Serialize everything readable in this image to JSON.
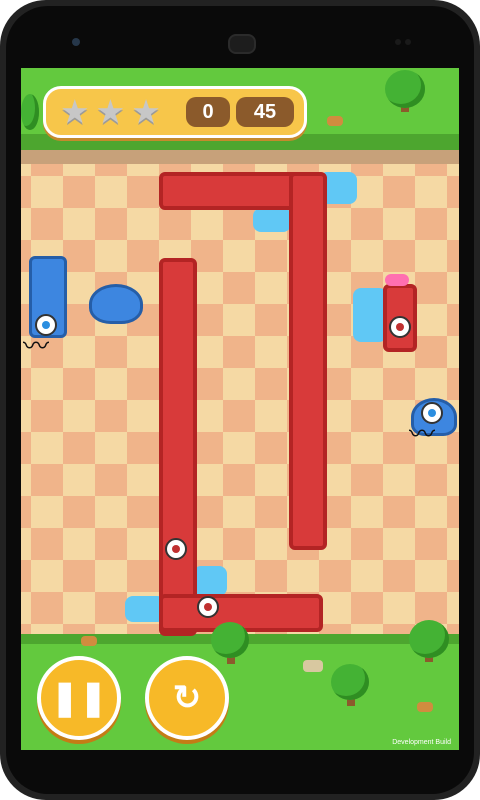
{
  "hud": {
    "stars_earned": 0,
    "stars_total": 3,
    "moves": "0",
    "limit": "45"
  },
  "controls": {
    "pause_icon": "pause-icon",
    "restart_icon": "restart-icon"
  },
  "footer": {
    "build_label": "Development Build"
  },
  "colors": {
    "snake_red": "#d83a3a",
    "water_blue": "#60c8f5",
    "monster_blue": "#3d86e0",
    "button_yellow": "#f7b928"
  }
}
